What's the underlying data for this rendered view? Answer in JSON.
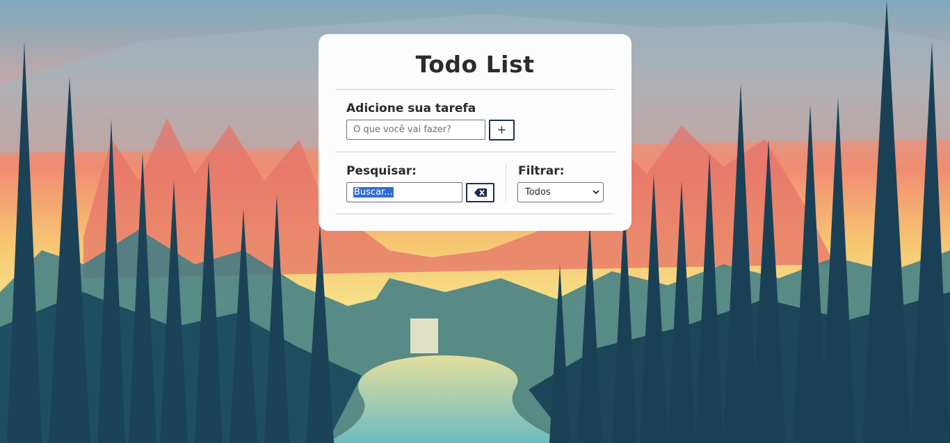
{
  "app": {
    "title": "Todo List"
  },
  "add": {
    "label": "Adicione sua tarefa",
    "placeholder": "O que você vai fazer?",
    "button_label": "+"
  },
  "search": {
    "label": "Pesquisar:",
    "value": "Buscar...",
    "clear_icon": "backspace-icon"
  },
  "filter": {
    "label": "Filtrar:",
    "selected": "Todos"
  },
  "colors": {
    "accent": "#1b2f55",
    "card": "#fdfdfd",
    "selection": "#2e6ed8"
  }
}
